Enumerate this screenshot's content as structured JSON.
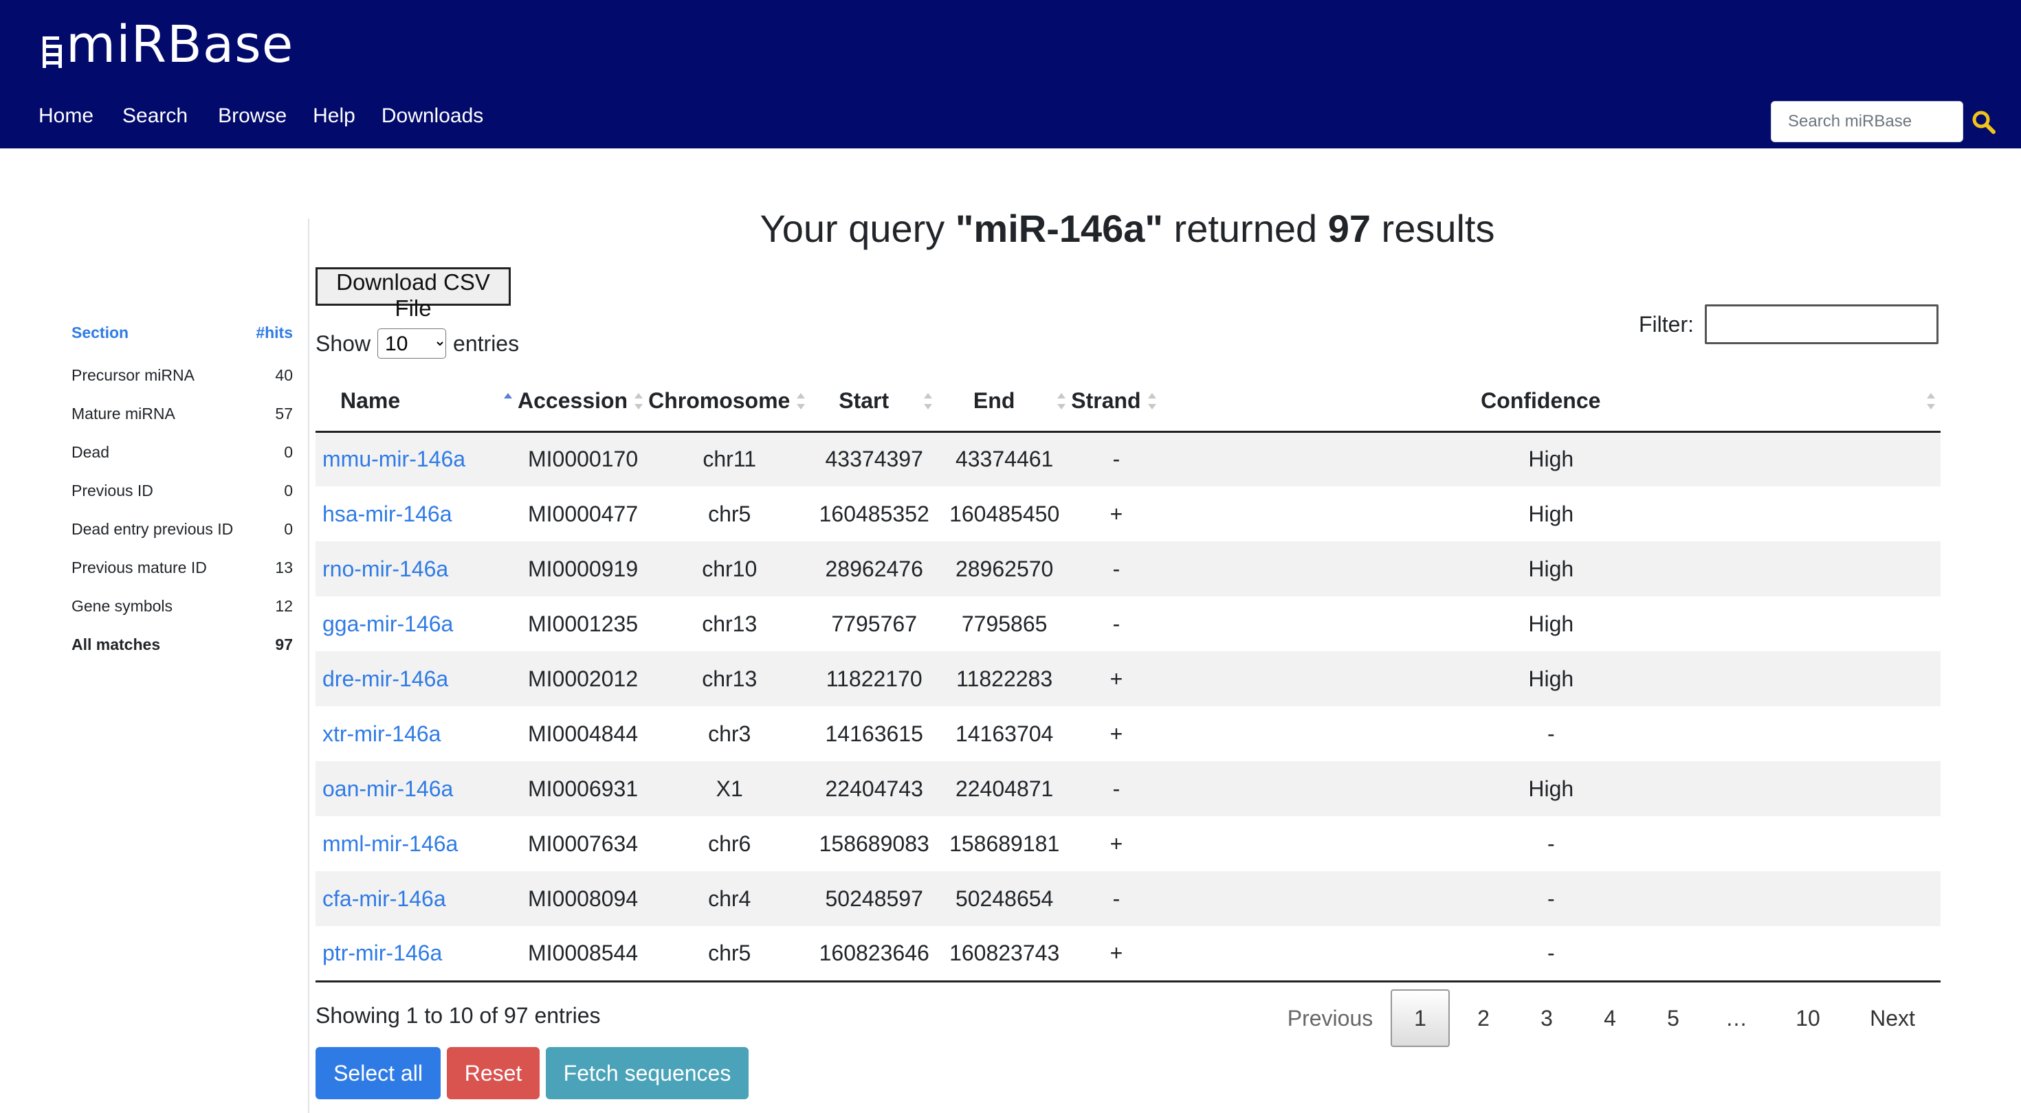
{
  "header": {
    "logo_text": "miRBase",
    "nav": [
      "Home",
      "Search",
      "Browse",
      "Help",
      "Downloads"
    ],
    "search_placeholder": "Search miRBase",
    "search_icon": "search-icon"
  },
  "colors": {
    "header_bg": "#020a6b",
    "link": "#2f7be5",
    "accent_icon": "#f0c419",
    "btn_select": "#2f7be5",
    "btn_reset": "#d9534f",
    "btn_fetch": "#4aa3b8"
  },
  "sidebar": {
    "head_section": "Section",
    "head_hits": "#hits",
    "rows": [
      {
        "label": "Precursor miRNA",
        "count": "40"
      },
      {
        "label": "Mature miRNA",
        "count": "57"
      },
      {
        "label": "Dead",
        "count": "0"
      },
      {
        "label": "Previous ID",
        "count": "0"
      },
      {
        "label": "Dead entry previous ID",
        "count": "0"
      },
      {
        "label": "Previous mature ID",
        "count": "13"
      },
      {
        "label": "Gene symbols",
        "count": "12"
      },
      {
        "label": "All matches",
        "count": "97"
      }
    ]
  },
  "main": {
    "title_prefix": "Your query ",
    "title_query": "\"miR-146a\"",
    "title_middle": " returned ",
    "title_count": "97",
    "title_suffix": " results",
    "csv_button": "Download CSV File",
    "show_label": "Show",
    "show_value": "10",
    "entries_label": "entries",
    "filter_label": "Filter:",
    "filter_value": "",
    "columns": [
      "Name",
      "Accession",
      "Chromosome",
      "Start",
      "End",
      "Strand",
      "Confidence"
    ],
    "rows": [
      {
        "name": "mmu-mir-146a",
        "accession": "MI0000170",
        "chromosome": "chr11",
        "start": "43374397",
        "end": "43374461",
        "strand": "-",
        "confidence": "High"
      },
      {
        "name": "hsa-mir-146a",
        "accession": "MI0000477",
        "chromosome": "chr5",
        "start": "160485352",
        "end": "160485450",
        "strand": "+",
        "confidence": "High"
      },
      {
        "name": "rno-mir-146a",
        "accession": "MI0000919",
        "chromosome": "chr10",
        "start": "28962476",
        "end": "28962570",
        "strand": "-",
        "confidence": "High"
      },
      {
        "name": "gga-mir-146a",
        "accession": "MI0001235",
        "chromosome": "chr13",
        "start": "7795767",
        "end": "7795865",
        "strand": "-",
        "confidence": "High"
      },
      {
        "name": "dre-mir-146a",
        "accession": "MI0002012",
        "chromosome": "chr13",
        "start": "11822170",
        "end": "11822283",
        "strand": "+",
        "confidence": "High"
      },
      {
        "name": "xtr-mir-146a",
        "accession": "MI0004844",
        "chromosome": "chr3",
        "start": "14163615",
        "end": "14163704",
        "strand": "+",
        "confidence": "-"
      },
      {
        "name": "oan-mir-146a",
        "accession": "MI0006931",
        "chromosome": "X1",
        "start": "22404743",
        "end": "22404871",
        "strand": "-",
        "confidence": "High"
      },
      {
        "name": "mml-mir-146a",
        "accession": "MI0007634",
        "chromosome": "chr6",
        "start": "158689083",
        "end": "158689181",
        "strand": "+",
        "confidence": "-"
      },
      {
        "name": "cfa-mir-146a",
        "accession": "MI0008094",
        "chromosome": "chr4",
        "start": "50248597",
        "end": "50248654",
        "strand": "-",
        "confidence": "-"
      },
      {
        "name": "ptr-mir-146a",
        "accession": "MI0008544",
        "chromosome": "chr5",
        "start": "160823646",
        "end": "160823743",
        "strand": "+",
        "confidence": "-"
      }
    ],
    "info": "Showing 1 to 10 of 97 entries",
    "pager": {
      "previous": "Previous",
      "pages": [
        "1",
        "2",
        "3",
        "4",
        "5"
      ],
      "ellipsis": "…",
      "last": "10",
      "next": "Next",
      "current": "1"
    },
    "buttons": {
      "select_all": "Select all",
      "reset": "Reset",
      "fetch": "Fetch sequences"
    }
  }
}
